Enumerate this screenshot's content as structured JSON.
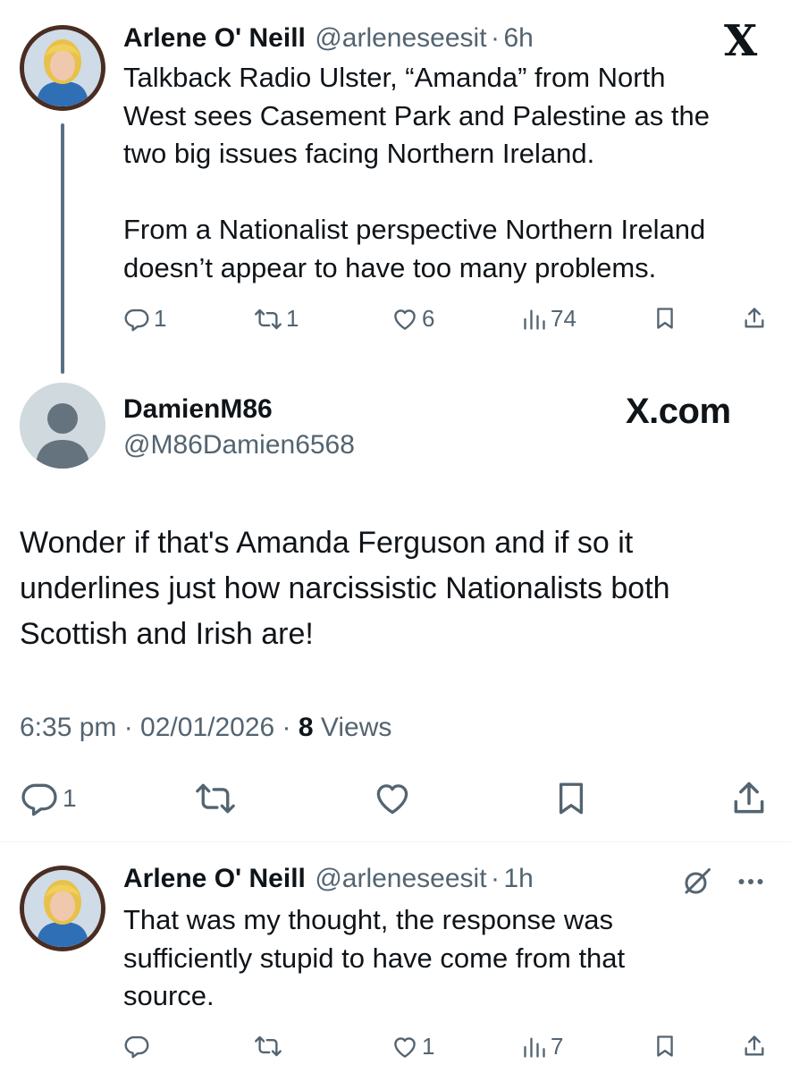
{
  "tweet1": {
    "name": "Arlene O' Neill",
    "handle": "@arleneseesit",
    "sep": "·",
    "time": "6h",
    "text": "Talkback Radio Ulster, “Amanda” from North\nWest sees Casement Park and Palestine as the\ntwo big issues facing Northern Ireland.\n\nFrom a Nationalist perspective Northern Ireland\ndoesn’t appear to have too many problems.",
    "replies": "1",
    "reposts": "1",
    "likes": "6",
    "views": "74"
  },
  "x_logo": "X",
  "x_com": "X.com",
  "tweet2": {
    "name": "DamienM86",
    "handle": "@M86Damien6568",
    "text": "Wonder if that's Amanda Ferguson and if so it\nunderlines just how narcissistic Nationalists both\nScottish and Irish are!",
    "timestamp": "6:35 pm · 02/01/2026 · ",
    "views_count": "8",
    "views_label": " Views",
    "replies": "1"
  },
  "tweet3": {
    "name": "Arlene O' Neill",
    "handle": "@arleneseesit",
    "sep": "·",
    "time": "1h",
    "text": "That was my thought, the response was\nsufficiently stupid to have come from that\nsource.",
    "likes": "1",
    "views": "7"
  },
  "icons": [
    "reply-icon",
    "repost-icon",
    "like-icon",
    "views-icon",
    "bookmark-icon",
    "share-icon",
    "grok-icon",
    "more-icon"
  ],
  "colors": {
    "text": "#0f1419",
    "muted": "#536471",
    "avatar_border": "#4a2d22"
  }
}
